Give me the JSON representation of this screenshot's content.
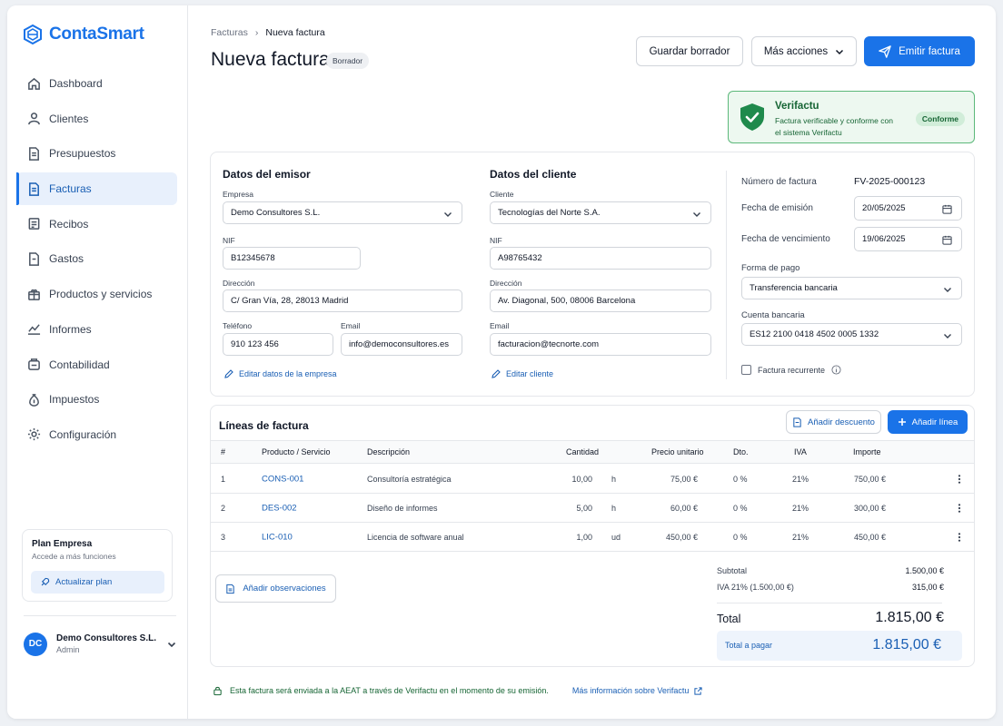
{
  "brand": {
    "name": "ContaSmart"
  },
  "sidebar": {
    "items": [
      {
        "label": "Dashboard",
        "icon": "home-icon"
      },
      {
        "label": "Clientes",
        "icon": "user-icon"
      },
      {
        "label": "Presupuestos",
        "icon": "document-icon"
      },
      {
        "label": "Facturas",
        "icon": "invoice-icon",
        "active": true
      },
      {
        "label": "Recibos",
        "icon": "receipt-icon"
      },
      {
        "label": "Gastos",
        "icon": "expense-icon"
      },
      {
        "label": "Productos y servicios",
        "icon": "box-icon"
      },
      {
        "label": "Informes",
        "icon": "chart-icon"
      },
      {
        "label": "Contabilidad",
        "icon": "ledger-icon"
      },
      {
        "label": "Impuestos",
        "icon": "tax-icon"
      },
      {
        "label": "Configuración",
        "icon": "gear-icon"
      }
    ],
    "plan": {
      "title": "Plan Empresa",
      "subtitle": "Accede a más funciones",
      "button": "Actualizar plan"
    },
    "user": {
      "initials": "DC",
      "name": "Demo Consultores S.L.",
      "role": "Admin"
    }
  },
  "header": {
    "breadcrumb": {
      "parent": "Facturas",
      "current": "Nueva factura"
    },
    "title": "Nueva factura",
    "status_badge": "Borrador",
    "actions": {
      "save_draft": "Guardar borrador",
      "more": "Más acciones",
      "emit": "Emitir factura"
    }
  },
  "verifactu": {
    "title": "Verifactu",
    "description": "Factura verificable y conforme con el sistema Verifactu",
    "badge": "Conforme"
  },
  "emisor": {
    "title": "Datos del emisor",
    "empresa_label": "Empresa",
    "empresa_value": "Demo Consultores S.L.",
    "nif_label": "NIF",
    "nif_value": "B12345678",
    "direccion_label": "Dirección",
    "direccion_value": "C/ Gran Vía, 28, 28013 Madrid",
    "telefono_label": "Teléfono",
    "telefono_value": "910 123 456",
    "email_label": "Email",
    "email_value": "info@democonsultores.es",
    "edit_link": "Editar datos de la empresa"
  },
  "cliente": {
    "title": "Datos del cliente",
    "cliente_label": "Cliente",
    "cliente_value": "Tecnologías del Norte S.A.",
    "nif_label": "NIF",
    "nif_value": "A98765432",
    "direccion_label": "Dirección",
    "direccion_value": "Av. Diagonal, 500, 08006 Barcelona",
    "email_label": "Email",
    "email_value": "facturacion@tecnorte.com",
    "edit_link": "Editar cliente"
  },
  "invoice_meta": {
    "numero_label": "Número de factura",
    "numero_value": "FV-2025-000123",
    "emision_label": "Fecha de emisión",
    "emision_value": "20/05/2025",
    "vencimiento_label": "Fecha de vencimiento",
    "vencimiento_value": "19/06/2025",
    "forma_pago_label": "Forma de pago",
    "forma_pago_value": "Transferencia bancaria",
    "cuenta_label": "Cuenta bancaria",
    "cuenta_value": "ES12 2100 0418 4502 0005 1332",
    "recurrente_label": "Factura recurrente",
    "recurrente_checked": false
  },
  "lines": {
    "title": "Líneas de factura",
    "discount_button": "Añadir descuento",
    "add_button": "Añadir línea",
    "columns": [
      "#",
      "Producto / Servicio",
      "Descripción",
      "Cantidad",
      "Precio unitario",
      "Dto.",
      "IVA",
      "Importe"
    ],
    "rows": [
      {
        "n": "1",
        "code": "CONS-001",
        "desc": "Consultoría estratégica",
        "qty": "10,00",
        "unit": "h",
        "price": "75,00 €",
        "dto": "0 %",
        "iva": "21%",
        "amount": "750,00 €"
      },
      {
        "n": "2",
        "code": "DES-002",
        "desc": "Diseño de informes",
        "qty": "5,00",
        "unit": "h",
        "price": "60,00 €",
        "dto": "0 %",
        "iva": "21%",
        "amount": "300,00 €"
      },
      {
        "n": "3",
        "code": "LIC-010",
        "desc": "Licencia de software anual",
        "qty": "1,00",
        "unit": "ud",
        "price": "450,00 €",
        "dto": "0 %",
        "iva": "21%",
        "amount": "450,00 €"
      }
    ],
    "observations_button": "Añadir observaciones",
    "totals": {
      "subtotal_label": "Subtotal",
      "subtotal_value": "1.500,00 €",
      "iva_label": "IVA 21% (1.500,00 €)",
      "iva_value": "315,00 €",
      "total_label": "Total",
      "total_value": "1.815,00 €",
      "to_pay_label": "Total a pagar",
      "to_pay_value": "1.815,00 €"
    }
  },
  "footer": {
    "note": "Esta factura será enviada a la AEAT a través de Verifactu en el momento de su emisión.",
    "link": "Más información sobre Verifactu"
  },
  "colors": {
    "accent": "#1a73e8",
    "success": "#166534",
    "success_bg": "#edf8f0"
  }
}
